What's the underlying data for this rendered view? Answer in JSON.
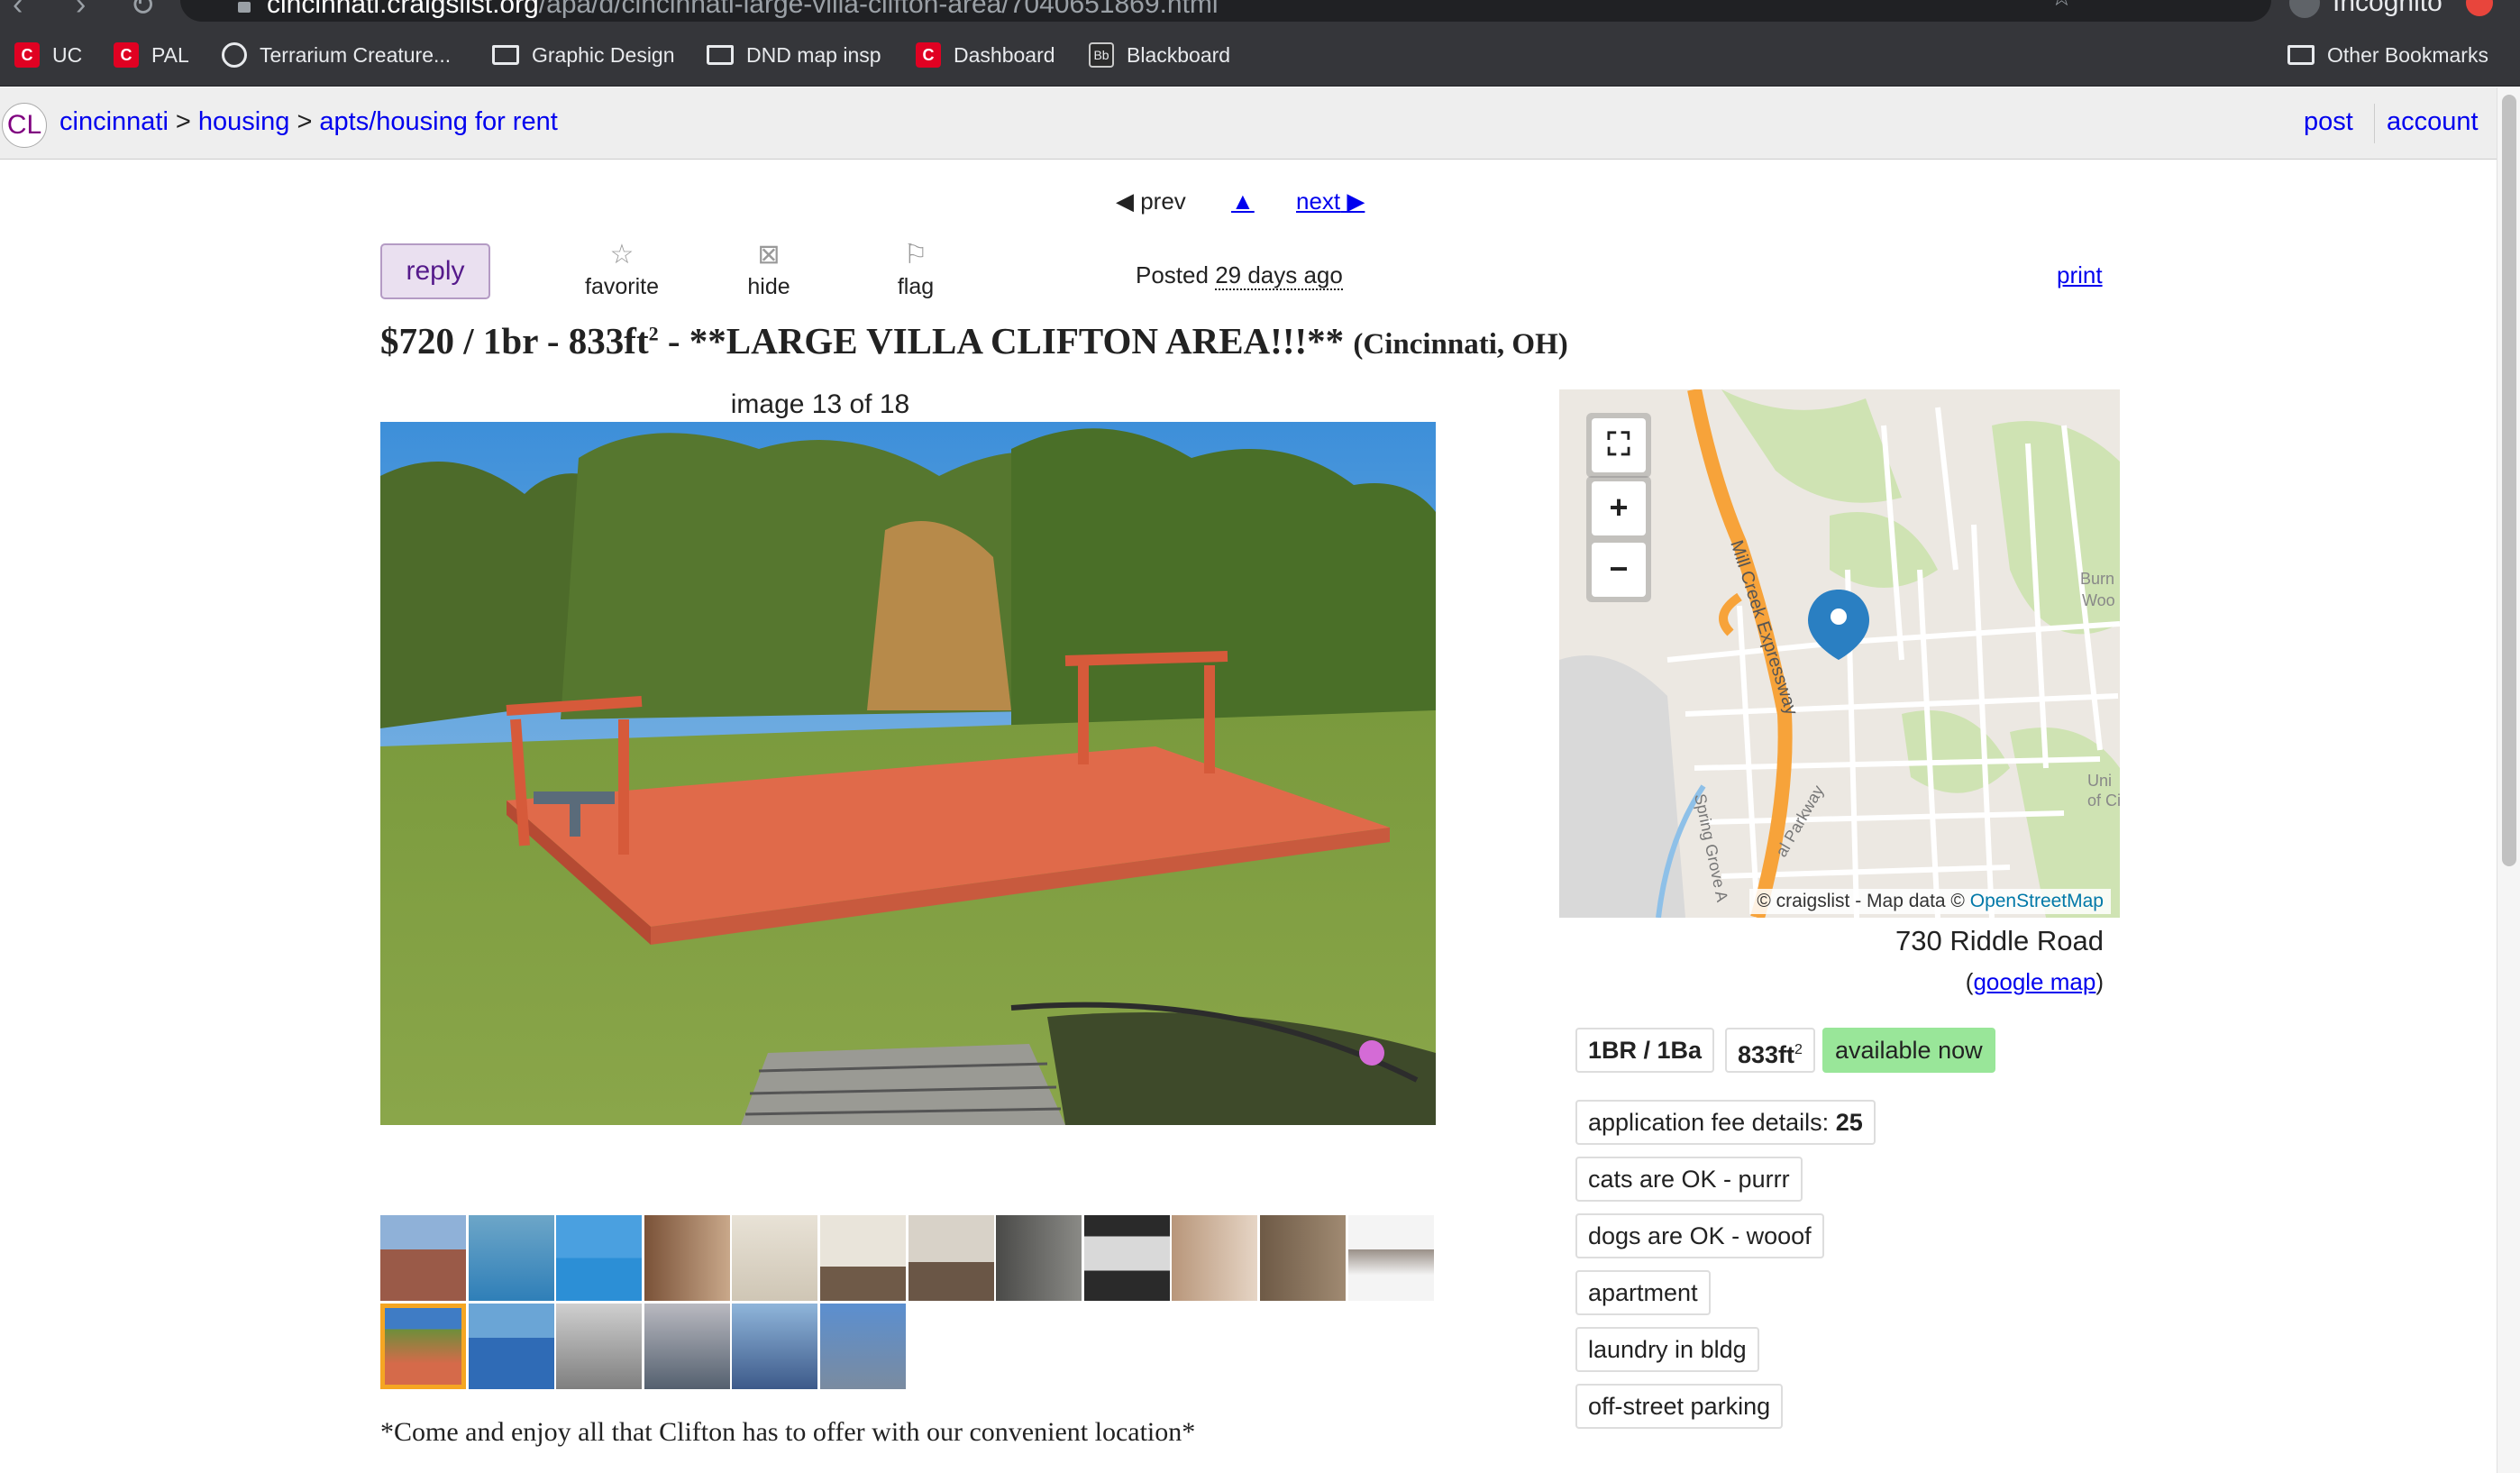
{
  "browser": {
    "url_host": "cincinnati.craigslist.org",
    "url_path": "/apa/d/cincinnati-large-villa-clifton-area/7040651869.html",
    "incognito_label": "Incognito",
    "bookmarks": [
      {
        "label": "UC",
        "icon": "uc-logo-icon"
      },
      {
        "label": "PAL",
        "icon": "uc-logo-icon"
      },
      {
        "label": "Terrarium Creature...",
        "icon": "globe-icon"
      },
      {
        "label": "Graphic Design",
        "icon": "folder-icon"
      },
      {
        "label": "DND map insp",
        "icon": "folder-icon"
      },
      {
        "label": "Dashboard",
        "icon": "uc-logo-icon"
      },
      {
        "label": "Blackboard",
        "icon": "blackboard-icon"
      }
    ],
    "other_bookmarks": "Other Bookmarks"
  },
  "header": {
    "logo": "CL",
    "breadcrumbs": [
      "cincinnati",
      "housing",
      "apts/housing for rent"
    ],
    "separator": ">",
    "post": "post",
    "account": "account"
  },
  "nav": {
    "prev": "prev",
    "up": "▲",
    "next": "next"
  },
  "actions": {
    "reply": "reply",
    "favorite": "favorite",
    "hide": "hide",
    "flag": "flag",
    "posted_label": "Posted",
    "posted_ago": "29 days ago",
    "print": "print"
  },
  "listing": {
    "price_title": "$720 / 1br - 833ft",
    "sup": "2",
    "headline": " - **LARGE VILLA CLIFTON AREA!!!** ",
    "location": "(Cincinnati, OH)",
    "image_counter": "image 13 of 18",
    "body_first_line": "*Come and enjoy all that Clifton has to offer with our convenient location*"
  },
  "map": {
    "attribution_prefix": "© craigslist - Map data © ",
    "attribution_link": "OpenStreetMap",
    "street_label_1": "Mill Creek Expressway",
    "street_label_2": "Spring Grove A",
    "street_label_3": "al Parkway",
    "place_label_1": "Burn",
    "place_label_2": "Woo",
    "place_label_3": "Uni",
    "place_label_4": "of Ci",
    "address": "730 Riddle Road",
    "google_map": "google map"
  },
  "attributes": {
    "br_ba": "1BR / 1Ba",
    "sqft": "833ft",
    "sqft_sup": "2",
    "available": "available now",
    "app_fee_label": "application fee details: ",
    "app_fee_value": "25",
    "cats": "cats are OK - purrr",
    "dogs": "dogs are OK - wooof",
    "type": "apartment",
    "laundry": "laundry in bldg",
    "parking": "off-street parking"
  },
  "colors": {
    "link": "#0000ee",
    "visited": "#551a8b",
    "available_bg": "#99e699",
    "selected_thumb": "#f5a623"
  }
}
